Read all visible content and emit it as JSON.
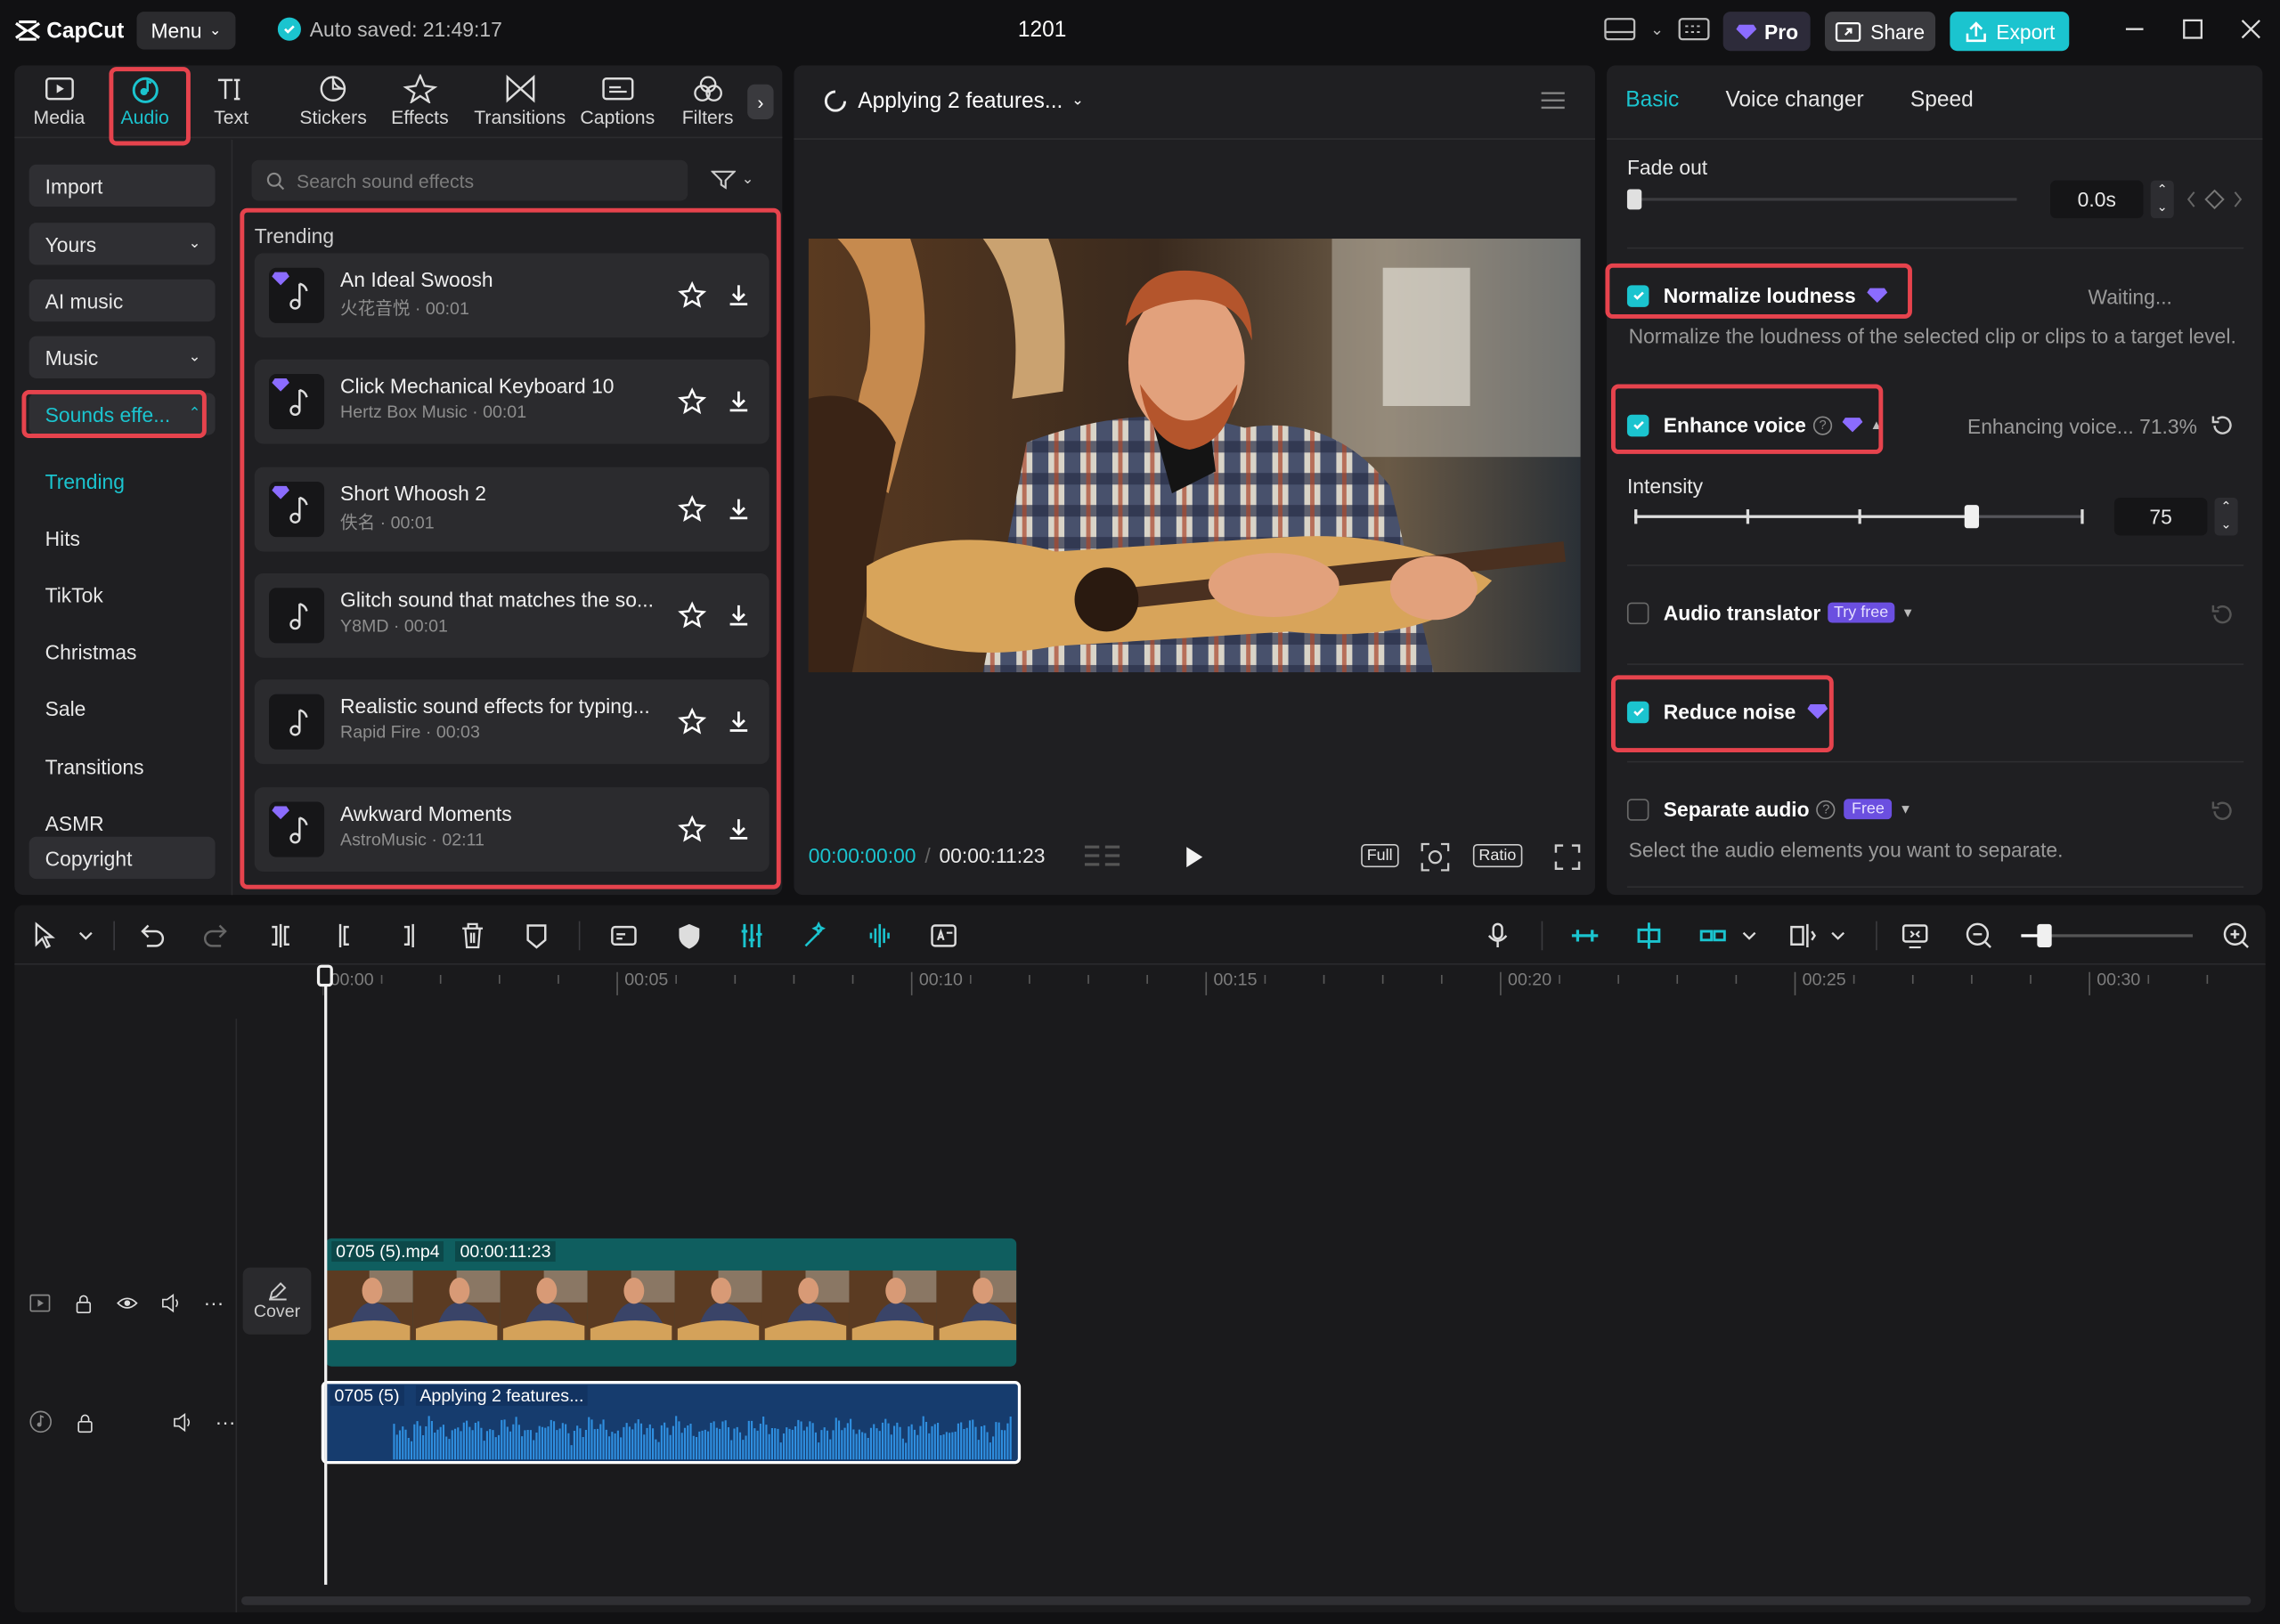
{
  "app": {
    "brand": "CapCut",
    "menu_label": "Menu",
    "autosave": "Auto saved: 21:49:17",
    "project_title": "1201",
    "pro_label": "Pro",
    "share_label": "Share",
    "export_label": "Export"
  },
  "toolbar": {
    "tabs": [
      {
        "label": "Media",
        "icon": "media-icon"
      },
      {
        "label": "Audio",
        "icon": "audio-icon",
        "active": true
      },
      {
        "label": "Text",
        "icon": "text-icon"
      },
      {
        "label": "Stickers",
        "icon": "stickers-icon"
      },
      {
        "label": "Effects",
        "icon": "effects-icon"
      },
      {
        "label": "Transitions",
        "icon": "transitions-icon"
      },
      {
        "label": "Captions",
        "icon": "captions-icon"
      },
      {
        "label": "Filters",
        "icon": "filters-icon"
      }
    ]
  },
  "sidebar": {
    "import": "Import",
    "yours": "Yours",
    "ai_music": "AI music",
    "music": "Music",
    "sound_effects": "Sounds effe...",
    "sub": [
      "Trending",
      "Hits",
      "TikTok",
      "Christmas",
      "Sale",
      "Transitions",
      "ASMR"
    ],
    "copyright": "Copyright"
  },
  "library": {
    "search_placeholder": "Search sound effects",
    "section": "Trending",
    "items": [
      {
        "title": "An Ideal Swoosh",
        "sub": "火花音悦 · 00:01",
        "pro": true
      },
      {
        "title": "Click Mechanical Keyboard 10",
        "sub": "Hertz Box Music · 00:01",
        "pro": true
      },
      {
        "title": "Short Whoosh 2",
        "sub": "佚名 · 00:01",
        "pro": true
      },
      {
        "title": "Glitch sound that matches the so...",
        "sub": "Y8MD · 00:01",
        "pro": false
      },
      {
        "title": "Realistic sound effects for typing...",
        "sub": "Rapid Fire · 00:03",
        "pro": false
      },
      {
        "title": "Awkward Moments",
        "sub": "AstroMusic · 02:11",
        "pro": true
      }
    ]
  },
  "player": {
    "status": "Applying 2 features...",
    "time_current": "00:00:00:00",
    "time_total": "00:00:11:23",
    "full_label": "Full",
    "ratio_label": "Ratio"
  },
  "props": {
    "tabs": [
      "Basic",
      "Voice changer",
      "Speed"
    ],
    "fade_out_label": "Fade out",
    "fade_out_value": "0.0s",
    "normalize_label": "Normalize loudness",
    "normalize_status": "Waiting...",
    "normalize_desc": "Normalize the loudness of the selected clip or clips to a target level.",
    "enhance_label": "Enhance voice",
    "enhance_status": "Enhancing voice... 71.3%",
    "intensity_label": "Intensity",
    "intensity_value": "75",
    "intensity_level": 0.75,
    "translator_label": "Audio translator",
    "translator_badge": "Try free",
    "reduce_noise_label": "Reduce noise",
    "separate_label": "Separate audio",
    "separate_badge": "Free",
    "separate_desc": "Select the audio elements you want to separate."
  },
  "timeline": {
    "ruler": [
      "00:00",
      "00:05",
      "00:10",
      "00:15",
      "00:20",
      "00:25",
      "00:30"
    ],
    "cover_label": "Cover",
    "video_clip_name": "0705 (5).mp4",
    "video_clip_duration": "00:00:11:23",
    "audio_clip_name": "0705 (5)",
    "audio_clip_status": "Applying 2 features..."
  },
  "colors": {
    "accent": "#1bc4cf",
    "highlight": "#e6434d",
    "pro": "#8b6cff"
  }
}
